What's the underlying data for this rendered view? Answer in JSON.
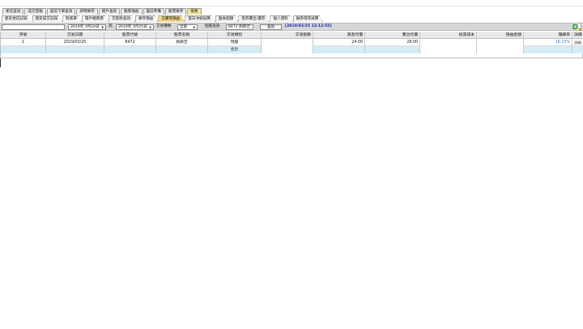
{
  "main_tabs": [
    {
      "label": "委託查詢",
      "active": false
    },
    {
      "label": "成交回報",
      "active": false
    },
    {
      "label": "當前下單查詢",
      "active": false
    },
    {
      "label": "即時庫存",
      "active": false
    },
    {
      "label": "帳戶查詢",
      "active": false
    },
    {
      "label": "動態損益",
      "active": false
    },
    {
      "label": "盤前準備",
      "active": false
    },
    {
      "label": "股票庫存",
      "active": false
    },
    {
      "label": "帳務",
      "active": true
    }
  ],
  "sub_tabs": [
    {
      "label": "歷史委託記錄",
      "active": false
    },
    {
      "label": "歷史成交記錄",
      "active": false
    },
    {
      "label": "對帳單",
      "active": false
    },
    {
      "label": "帳戶總資產",
      "active": false
    },
    {
      "label": "交割款查詢",
      "active": false
    },
    {
      "label": "庫存損益",
      "active": false
    },
    {
      "label": "已實現損益",
      "active": true
    },
    {
      "label": "當日沖銷試算",
      "active": false
    },
    {
      "label": "盤後配額",
      "active": false
    },
    {
      "label": "借券賣出/還券",
      "active": false
    },
    {
      "label": "個人資料",
      "active": false
    },
    {
      "label": "融券借券試算",
      "active": false
    }
  ],
  "toolbar": {
    "start_date": "2019年 3月24日",
    "to_label": "到",
    "end_date": "2019年 3月25日",
    "trade_type_label": "交易種類",
    "trade_type_value": "全部",
    "stock_query_label": "個股查詢",
    "stock_query_value": "8472 夠麻吉",
    "query_button": "查詢",
    "timestamp": "[2019/03/25 12:12:55]"
  },
  "table": {
    "headers": [
      "序號",
      "交易日期",
      "股票代號",
      "股票名稱",
      "交易類別",
      "交易股數",
      "買進均價",
      "賣出均價",
      "投資成本",
      "損益金額",
      "報酬率",
      "詳細"
    ],
    "rows": [
      {
        "seq": "1",
        "date": "2019/03/25",
        "code": "8472",
        "name": "夠麻吉",
        "type": "現股",
        "shares": "",
        "buy_avg": "24.00",
        "sell_avg": "28.00",
        "cost": "",
        "pnl": "",
        "roi": "16.15%",
        "detail": "詳細"
      }
    ],
    "total_label": "合計"
  },
  "colors": {
    "active_main_tab": "#f4e49a",
    "active_sub_tab": "#f1d78a",
    "header_bg": "#e9e9e9",
    "total_row_bg": "#d5ecf7",
    "toolbar_bg": "#d7d7d7",
    "timestamp_color": "#1b1bb0",
    "roi_color": "#2f7fc6"
  },
  "icons": {
    "export": "excel-export-icon"
  }
}
